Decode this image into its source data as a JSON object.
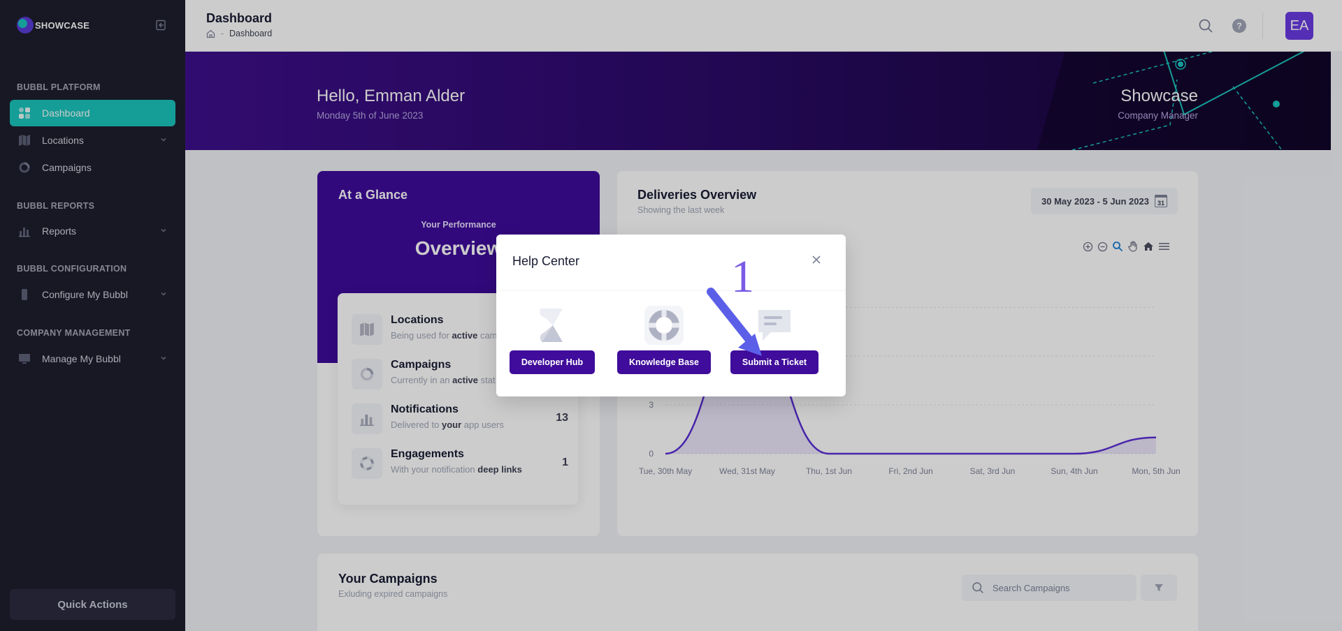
{
  "app": {
    "logo_text": "SHOWCASE"
  },
  "sidebar": {
    "sections": [
      {
        "title": "BUBBL PLATFORM"
      },
      {
        "title": "BUBBL REPORTS"
      },
      {
        "title": "BUBBL CONFIGURATION"
      },
      {
        "title": "COMPANY MANAGEMENT"
      }
    ],
    "items": [
      {
        "label": "Dashboard",
        "icon": "dashboard-icon",
        "active": true
      },
      {
        "label": "Locations",
        "icon": "map-icon"
      },
      {
        "label": "Campaigns",
        "icon": "donut-icon"
      },
      {
        "label": "Reports",
        "icon": "chart-icon"
      },
      {
        "label": "Configure My Bubbl",
        "icon": "phone-icon"
      },
      {
        "label": "Manage My Bubbl",
        "icon": "monitor-icon"
      }
    ],
    "quick_actions_label": "Quick Actions"
  },
  "header": {
    "title": "Dashboard",
    "breadcrumb": [
      "Dashboard"
    ],
    "avatar_initials": "EA"
  },
  "banner": {
    "greeting": "Hello, Emman Alder",
    "date": "Monday 5th of June 2023",
    "company": "Showcase",
    "role": "Company Manager"
  },
  "glance": {
    "title": "At a Glance",
    "perf_label": "Your Performance",
    "perf_big": "Overview",
    "stats": [
      {
        "title": "Locations",
        "sub_pre": "Being used for ",
        "sub_bold": "active",
        "sub_post": " cam",
        "value": ""
      },
      {
        "title": "Campaigns",
        "sub_pre": "Currently in an ",
        "sub_bold": "active",
        "sub_post": " stat",
        "value": ""
      },
      {
        "title": "Notifications",
        "sub_pre": "Delivered to ",
        "sub_bold": "your",
        "sub_post": " app users",
        "value": "13"
      },
      {
        "title": "Engagements",
        "sub_pre": "With your notification ",
        "sub_bold": "deep links",
        "sub_post": "",
        "value": "1"
      }
    ]
  },
  "deliveries": {
    "title": "Deliveries Overview",
    "subtitle": "Showing the last week",
    "date_range": "30 May 2023 - 5 Jun 2023",
    "calendar_day": "31"
  },
  "chart_data": {
    "type": "area",
    "x": [
      "Tue, 30th May",
      "Wed, 31st May",
      "Thu, 1st Jun",
      "Fri, 2nd Jun",
      "Sat, 3rd Jun",
      "Sun, 4th Jun",
      "Mon, 5th Jun"
    ],
    "y_ticks": [
      "0",
      "3"
    ],
    "series": [
      {
        "values": [
          0,
          8,
          0,
          0,
          0,
          0,
          1
        ]
      }
    ],
    "color": "#5b2fd6"
  },
  "campaigns": {
    "title": "Your Campaigns",
    "subtitle": "Exluding expired campaigns",
    "search_placeholder": "Search Campaigns"
  },
  "modal": {
    "title": "Help Center",
    "options": [
      {
        "label": "Developer Hub",
        "icon": "developer-hub-icon"
      },
      {
        "label": "Knowledge Base",
        "icon": "lifebuoy-icon"
      },
      {
        "label": "Submit a Ticket",
        "icon": "chat-bubble-icon"
      }
    ]
  },
  "annotation": {
    "step_number": "1",
    "color": "#5b5fe8"
  }
}
